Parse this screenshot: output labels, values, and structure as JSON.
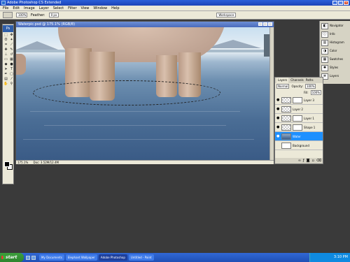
{
  "window": {
    "title": "Adobe Photoshop CS Extended"
  },
  "menu": {
    "items": [
      "File",
      "Edit",
      "Image",
      "Layer",
      "Select",
      "Filter",
      "View",
      "Window",
      "Help"
    ]
  },
  "options": {
    "zoom_value": "100%",
    "feather_label": "Feather:",
    "feather_value": "0 px",
    "workspace_label": "Workspace"
  },
  "document": {
    "title": "Waterpic.psd @ 175.1% (RGB/8)",
    "status_zoom": "175.1%",
    "status_doc": "Doc: 3.52M/12.4M"
  },
  "right_panel": {
    "items": [
      "Navigator",
      "Info",
      "Histogram",
      "Color",
      "Swatches",
      "Styles",
      "Layers"
    ]
  },
  "layers": {
    "tabs": [
      "Layers",
      "Channels",
      "Paths"
    ],
    "blend_mode": "Normal",
    "opacity_label": "Opacity:",
    "opacity": "100%",
    "fill_label": "Fill:",
    "fill": "100%",
    "items": [
      {
        "name": "Layer 3"
      },
      {
        "name": "Layer 2"
      },
      {
        "name": "Layer 1"
      },
      {
        "name": "Shape 1"
      },
      {
        "name": "Water"
      },
      {
        "name": "Background"
      }
    ]
  },
  "taskbar": {
    "start_label": "start",
    "tasks": [
      "My Documents",
      "Elephant Wallpaper",
      "Adobe Photoshop",
      "Untitled - Paint"
    ],
    "clock": "3:10 PM"
  },
  "colors": {
    "accent": "#1e90ff",
    "titlebar": "#2b5fd9",
    "taskbar": "#3168d5"
  }
}
